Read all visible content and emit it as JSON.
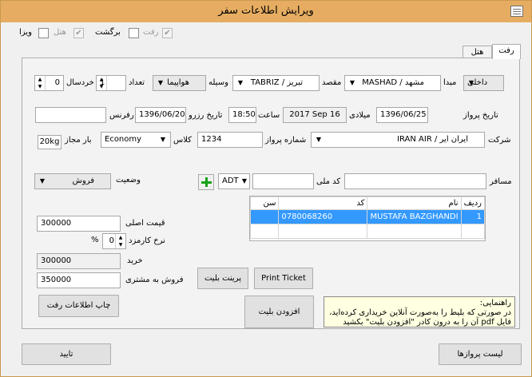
{
  "window": {
    "title": "ویرایش اطلاعات سفر"
  },
  "options": {
    "outbound_label": "رفت",
    "hotel_label": "هتل",
    "return_label": "برگشت",
    "visa_label": "ویزا",
    "check_mark": "✔"
  },
  "tabs": [
    {
      "label": "رفت"
    },
    {
      "label": "هتل"
    }
  ],
  "route": {
    "trip_type": "داخلی",
    "origin_label": "مبدا",
    "origin": "MASHAD / مشهد",
    "destination_label": "مقصد",
    "destination": "TABRIZ / تبریز",
    "vehicle_label": "وسیله",
    "vehicle": "هواپیما",
    "count_label": "تعداد",
    "count": "1",
    "child_label": "خردسال",
    "child_count": "0"
  },
  "dates": {
    "flight_date_label": "تاریخ پرواز",
    "flight_date": "1396/06/25",
    "gregorian_label": "میلادی",
    "gregorian_date": "2017 Sep 16",
    "time_label": "ساعت",
    "time": "18:50",
    "booking_date_label": "تاریخ رزرو",
    "booking_date": "1396/06/20",
    "reference_label": "رفرنس",
    "reference": ""
  },
  "flight": {
    "company_label": "شرکت",
    "company": "IRAN AIR / ایران ایر",
    "flight_number_label": "شماره پرواز",
    "flight_number": "1234",
    "class_label": "کلاس",
    "class": "Economy",
    "baggage_label": "بار مجاز",
    "baggage": "20kg"
  },
  "passenger": {
    "passenger_label": "مسافر",
    "passenger": "",
    "national_code_label": "کد ملی",
    "national_code": "",
    "age_type": "ADT",
    "status_label": "وضعیت",
    "status": "فروش"
  },
  "grid": {
    "columns": [
      "ردیف",
      "نام",
      "کد",
      "سن"
    ],
    "rows": [
      [
        "1",
        "MUSTAFA BAZGHANDI",
        "0780068260",
        ""
      ]
    ]
  },
  "pricing": {
    "base_price_label": "قیمت اصلی",
    "base_price": "300000",
    "commission_label": "نرخ کارمزد",
    "commission": "0",
    "percent_sign": "%",
    "purchase_label": "خرید",
    "purchase": "300000",
    "sale_label": "فروش به مشتری",
    "sale": "350000"
  },
  "buttons": {
    "print_outbound": "چاپ اطلاعات رفت",
    "print_ticket_fa": "پرینت بلیت",
    "print_ticket": "Print Ticket",
    "add_ticket": "افزودن بلیت",
    "confirm": "تایید",
    "flight_list": "لیست پروازها"
  },
  "help": {
    "title": "راهنمایی:",
    "line1": "در صورتی که بلیط را به‌صورت آنلاین خریداری کرده‌اید،",
    "line2": "فایل pdf آن را به درون کادر \"افزودن بلیت\" بکشید"
  },
  "icons": {
    "dropdown": "chevron-down-icon",
    "plus": "plus-icon",
    "app": "app-menu-icon"
  },
  "colors": {
    "titlebar": "#e6ad62",
    "selection": "#3399ff",
    "plus": "#17a317",
    "note": "#ffffe1"
  }
}
